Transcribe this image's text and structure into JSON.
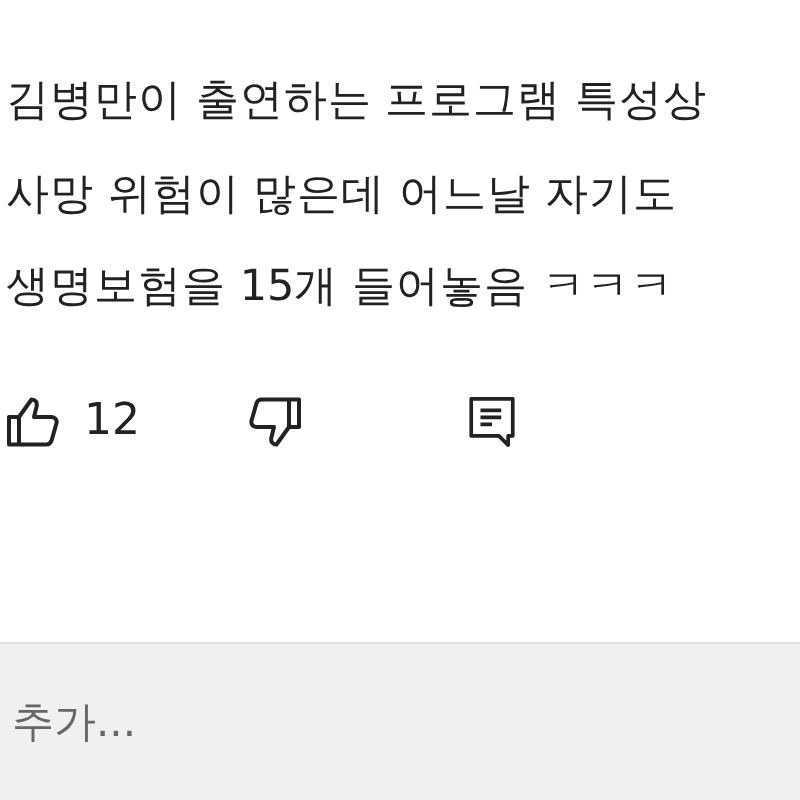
{
  "comment": {
    "lines": [
      "김병만이 출연하는 프로그램 특성상",
      "사망 위험이 많은데 어느날 자기도",
      "생명보험을 15개 들어놓음 ㅋㅋㅋ"
    ]
  },
  "actions": {
    "like_count": "12"
  },
  "reply_field": {
    "placeholder": "추가..."
  }
}
